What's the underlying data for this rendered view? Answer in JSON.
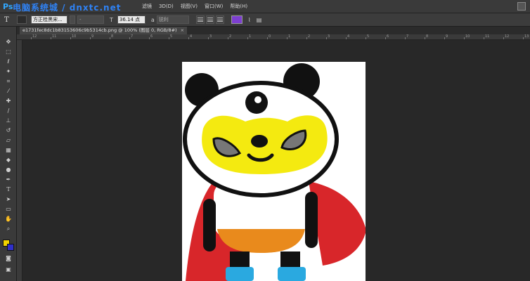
{
  "app": {
    "logo": "Ps",
    "watermark": "电脑系统城 / dnxtc.net"
  },
  "menu": {
    "items": [
      "滤镜",
      "3D(D)",
      "视图(V)",
      "窗口(W)",
      "帮助(H)"
    ]
  },
  "options": {
    "tool_glyph": "T",
    "font_family": "方正桂黑宋...",
    "font_style": "-",
    "font_size": "36.14 点",
    "antialias": "锐利"
  },
  "document": {
    "tab_title": "e1731fec8dc1b83153606c9b5314cb.png @ 100% (图层 0, RGB/8#)",
    "close_glyph": "×"
  },
  "ruler": {
    "h_labels": [
      "12",
      "11",
      "10",
      "9",
      "8",
      "7",
      "6",
      "5",
      "4",
      "3",
      "2",
      "1",
      "0",
      "1",
      "2",
      "3",
      "4",
      "5",
      "6",
      "7",
      "8",
      "9",
      "10",
      "11",
      "12",
      "13"
    ]
  },
  "colors": {
    "foreground": "#f2d300",
    "background": "#2f2fc8",
    "text_color": "#7d3fd0",
    "accent": "#31a8ff"
  },
  "icons": [
    "move-icon",
    "marquee-icon",
    "lasso-icon",
    "magic-wand-icon",
    "crop-icon",
    "eyedropper-icon",
    "healing-icon",
    "brush-icon",
    "stamp-icon",
    "history-brush-icon",
    "eraser-icon",
    "gradient-icon",
    "blur-icon",
    "dodge-icon",
    "pen-icon",
    "type-icon",
    "path-select-icon",
    "shape-icon",
    "hand-icon",
    "zoom-icon"
  ]
}
